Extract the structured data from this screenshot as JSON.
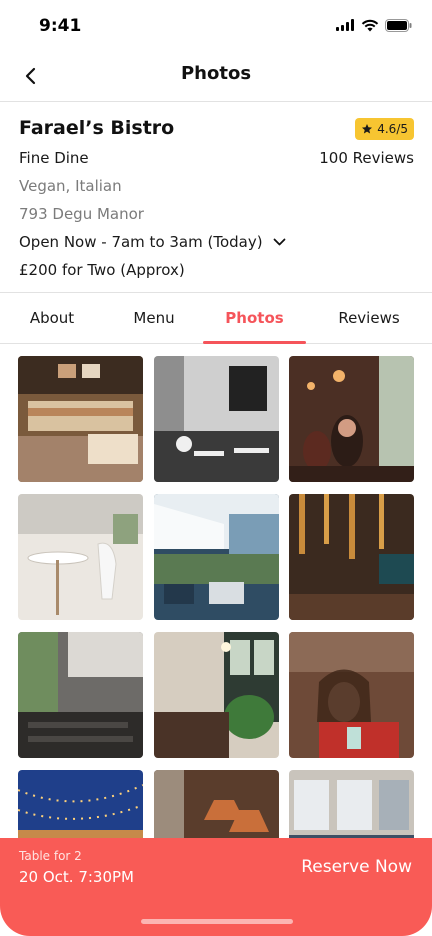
{
  "status_bar": {
    "time": "9:41"
  },
  "header": {
    "title": "Photos"
  },
  "restaurant": {
    "name": "Farael’s Bistro",
    "rating": "4.6/5",
    "category": "Fine Dine",
    "reviews": "100 Reviews",
    "cuisine": "Vegan, Italian",
    "address": "793 Degu Manor",
    "hours": "Open Now - 7am to 3am (Today)",
    "price": "£200 for Two (Approx)"
  },
  "tabs": [
    {
      "label": "About",
      "active": false
    },
    {
      "label": "Menu",
      "active": false
    },
    {
      "label": "Photos",
      "active": true
    },
    {
      "label": "Reviews",
      "active": false
    }
  ],
  "photos": [
    "cafe-pastry-counter",
    "black-white-restaurant",
    "warm-cafe-patrons",
    "white-chairs-dining",
    "terrace-umbrellas",
    "dark-wood-bar",
    "industrial-window-hall",
    "green-plant-dining",
    "woman-at-window",
    "string-lights-patio",
    "copper-lamp-room",
    "bright-dining-hall"
  ],
  "reservation": {
    "label": "Table for 2",
    "datetime": "20 Oct. 7:30PM",
    "button": "Reserve Now"
  },
  "colors": {
    "accent": "#f5545a",
    "rating_badge": "#f7c531",
    "reserve_bar": "#f95b56"
  }
}
